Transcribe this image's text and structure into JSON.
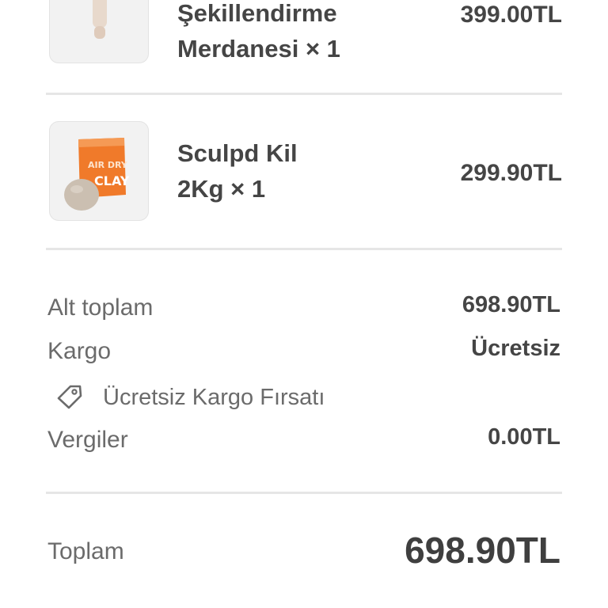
{
  "cart_items": [
    {
      "name_line1": "Şekillendirme",
      "name_line2": "Merdanesi × 1",
      "price": "399.00TL",
      "image_icon": "rolling-pin-icon"
    },
    {
      "name_line1": "Sculpd Kil",
      "name_line2": "2Kg × 1",
      "price": "299.90TL",
      "image_icon": "clay-package-icon"
    }
  ],
  "summary": {
    "subtotal_label": "Alt toplam",
    "subtotal_value": "698.90TL",
    "shipping_label": "Kargo",
    "shipping_value": "Ücretsiz",
    "discount_text": "Ücretsiz Kargo Fırsatı",
    "discount_icon": "tag-icon",
    "taxes_label": "Vergiler",
    "taxes_value": "0.00TL",
    "total_label": "Toplam",
    "total_value": "698.90TL"
  },
  "colors": {
    "package_orange": "#f07a2a",
    "text_dark": "#454545",
    "text_muted": "#6b6b6b",
    "divider": "#e6e6e6"
  }
}
